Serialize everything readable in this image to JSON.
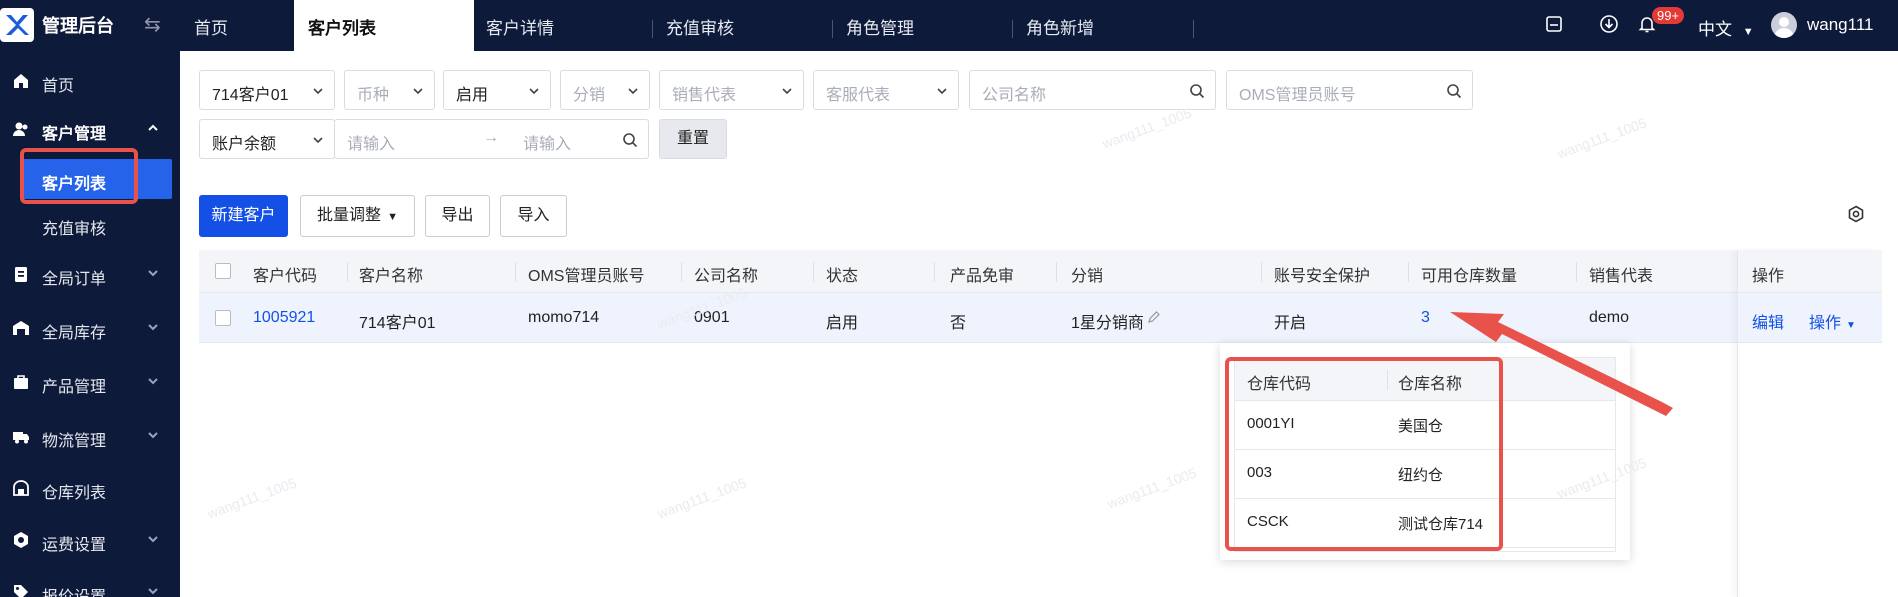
{
  "app": {
    "title": "管理后台"
  },
  "tabs": [
    "首页",
    "客户列表",
    "客户详情",
    "充值审核",
    "角色管理",
    "角色新增"
  ],
  "header": {
    "notification_count": "99+",
    "language": "中文",
    "username": "wang111"
  },
  "sidebar": {
    "items": [
      {
        "label": "首页",
        "icon": "home-icon"
      },
      {
        "label": "客户管理",
        "icon": "users-icon"
      },
      {
        "label": "客户列表"
      },
      {
        "label": "充值审核"
      },
      {
        "label": "全局订单",
        "icon": "clipboard-icon"
      },
      {
        "label": "全局库存",
        "icon": "warehouse-icon"
      },
      {
        "label": "产品管理",
        "icon": "package-icon"
      },
      {
        "label": "物流管理",
        "icon": "truck-icon"
      },
      {
        "label": "仓库列表",
        "icon": "store-icon"
      },
      {
        "label": "运费设置",
        "icon": "coin-icon"
      },
      {
        "label": "报价设置",
        "icon": "tag-icon"
      }
    ]
  },
  "filters": {
    "customer": "714客户01",
    "currency_placeholder": "币种",
    "status": "启用",
    "distribution_placeholder": "分销",
    "sales_rep_placeholder": "销售代表",
    "cs_rep_placeholder": "客服代表",
    "company_placeholder": "公司名称",
    "oms_placeholder": "OMS管理员账号",
    "balance_label": "账户余额",
    "range_from_placeholder": "请输入",
    "range_to_placeholder": "请输入",
    "range_arrow": "→",
    "reset": "重置"
  },
  "toolbar": {
    "new_customer": "新建客户",
    "batch_adjust": "批量调整",
    "export": "导出",
    "import": "导入"
  },
  "table": {
    "columns": [
      "客户代码",
      "客户名称",
      "OMS管理员账号",
      "公司名称",
      "状态",
      "产品免审",
      "分销",
      "账号安全保护",
      "可用仓库数量",
      "销售代表",
      "操作"
    ],
    "rows": [
      {
        "code": "1005921",
        "name": "714客户01",
        "oms": "momo714",
        "company": "0901",
        "status": "启用",
        "exempt": "否",
        "distribution": "1星分销商",
        "security": "开启",
        "warehouse_count": "3",
        "sales_rep": "demo",
        "edit": "编辑",
        "ops": "操作"
      }
    ]
  },
  "popover": {
    "columns": [
      "仓库代码",
      "仓库名称"
    ],
    "rows": [
      {
        "code": "0001YI",
        "name": "美国仓"
      },
      {
        "code": "003",
        "name": "纽约仓"
      },
      {
        "code": "CSCK",
        "name": "测试仓库714"
      }
    ]
  },
  "watermark": "wang111_1005",
  "colors": {
    "topbar": "#0e1a3a",
    "primary": "#1550e6",
    "annotation": "#e8524a"
  }
}
